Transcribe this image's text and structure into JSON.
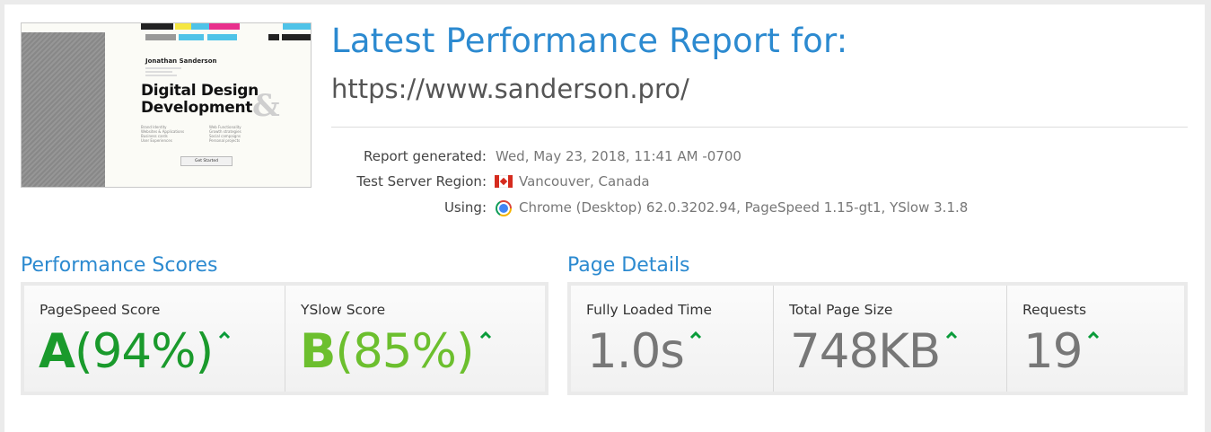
{
  "report": {
    "title": "Latest Performance Report for:",
    "url": "https://www.sanderson.pro/",
    "meta": [
      {
        "label": "Report generated:",
        "value": "Wed, May 23, 2018, 11:41 AM -0700"
      },
      {
        "label": "Test Server Region:",
        "value": "Vancouver, Canada",
        "icon": "canada-flag-icon"
      },
      {
        "label": "Using:",
        "value": "Chrome (Desktop) 62.0.3202.94, PageSpeed 1.15-gt1, YSlow 3.1.8",
        "icon": "chrome-icon"
      }
    ]
  },
  "thumbnail": {
    "name": "Jonathan Sanderson",
    "headline_1": "Digital Design",
    "headline_2": "Development",
    "ampersand": "&",
    "list_left": [
      "Brand Identity",
      "Websites & Applications",
      "Business cards",
      "User Experiences"
    ],
    "list_right": [
      "Web Functionality",
      "Growth strategies",
      "Social campaigns",
      "Personal projects"
    ],
    "button": "Get Started",
    "colors": [
      "#222222",
      "#f5e642",
      "#e8308c",
      "#4fc3e8"
    ]
  },
  "scores": {
    "title": "Performance Scores",
    "pagespeed": {
      "label": "PageSpeed Score",
      "grade": "A",
      "percent": "(94%)",
      "color": "#1a9a2c",
      "trend": "up"
    },
    "yslow": {
      "label": "YSlow Score",
      "grade": "B",
      "percent": "(85%)",
      "color": "#6cbf2e",
      "trend": "up"
    }
  },
  "details": {
    "title": "Page Details",
    "load_time": {
      "label": "Fully Loaded Time",
      "value": "1.0s",
      "trend": "up"
    },
    "page_size": {
      "label": "Total Page Size",
      "value": "748KB",
      "trend": "up"
    },
    "requests": {
      "label": "Requests",
      "value": "19",
      "trend": "up"
    }
  },
  "colors": {
    "accent": "#2c8ad0",
    "trend_up": "#0a9b3a"
  }
}
